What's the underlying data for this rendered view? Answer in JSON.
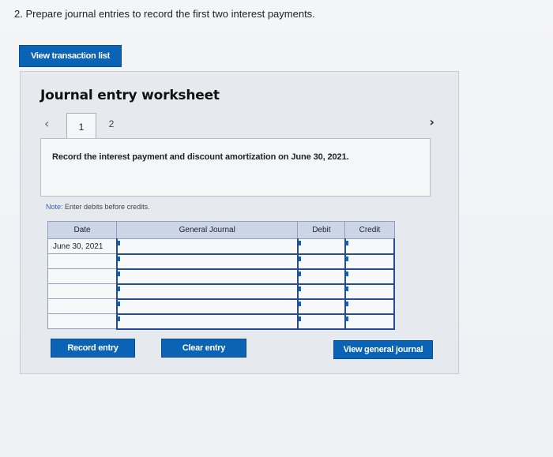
{
  "question": "2. Prepare journal entries to record the first two interest payments.",
  "buttons": {
    "view_transaction_list": "View transaction list",
    "record_entry": "Record entry",
    "clear_entry": "Clear entry",
    "view_general_journal": "View general journal"
  },
  "worksheet": {
    "title": "Journal entry worksheet",
    "tabs": [
      "1",
      "2"
    ],
    "active_tab": "1",
    "instruction": "Record the interest payment and discount amortization on June 30, 2021.",
    "note_prefix": "Note:",
    "note_text": " Enter debits before credits."
  },
  "table": {
    "headers": [
      "Date",
      "General Journal",
      "Debit",
      "Credit"
    ],
    "rows": [
      {
        "date": "June 30, 2021",
        "account": "",
        "debit": "",
        "credit": ""
      },
      {
        "date": "",
        "account": "",
        "debit": "",
        "credit": ""
      },
      {
        "date": "",
        "account": "",
        "debit": "",
        "credit": ""
      },
      {
        "date": "",
        "account": "",
        "debit": "",
        "credit": ""
      },
      {
        "date": "",
        "account": "",
        "debit": "",
        "credit": ""
      },
      {
        "date": "",
        "account": "",
        "debit": "",
        "credit": ""
      }
    ]
  },
  "icons": {
    "prev": "chevron-left-icon",
    "next": "chevron-right-icon"
  },
  "colors": {
    "button_blue": "#0b63b5",
    "header_bg": "#cbd5e6",
    "grid_blue": "#244d96"
  }
}
